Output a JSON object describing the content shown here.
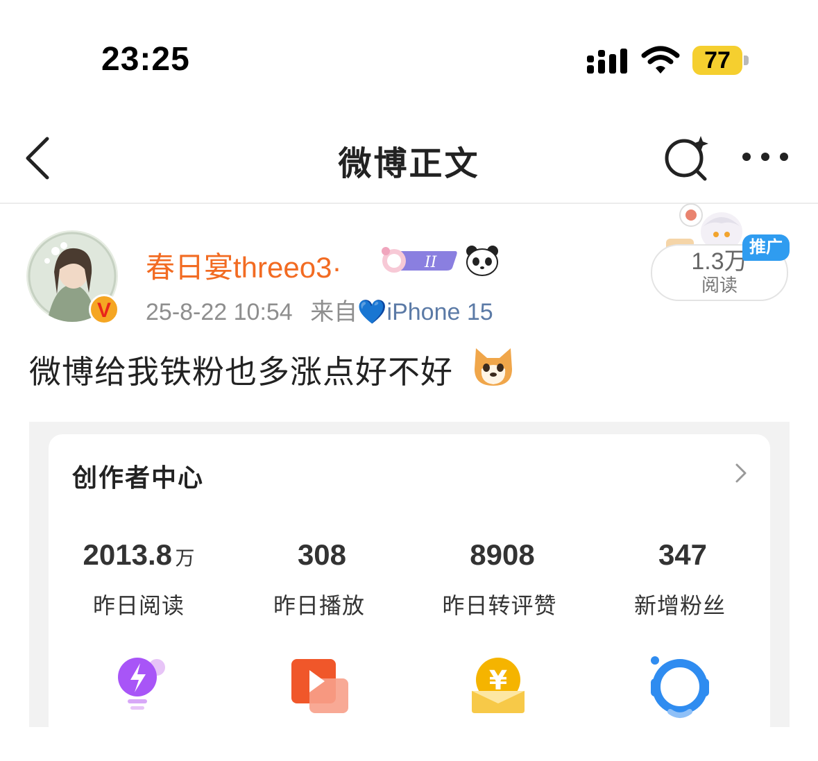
{
  "status_bar": {
    "time": "23:25",
    "battery": "77"
  },
  "nav": {
    "title": "微博正文"
  },
  "post": {
    "username": "春日宴threeo3·",
    "time": "25-8-22 10:54",
    "source_prefix": "来自",
    "device": "iPhone 15",
    "text": "微博给我铁粉也多涨点好不好",
    "reads": {
      "count": "1.3万",
      "label": "阅读",
      "tag": "推广"
    }
  },
  "creator_center": {
    "title": "创作者中心",
    "stats": [
      {
        "value": "2013.8",
        "unit": "万",
        "label": "昨日阅读"
      },
      {
        "value": "308",
        "unit": "",
        "label": "昨日播放"
      },
      {
        "value": "8908",
        "unit": "",
        "label": "昨日转评赞"
      },
      {
        "value": "347",
        "unit": "",
        "label": "新增粉丝"
      }
    ],
    "tools": [
      {
        "icon": "lightbulb-icon",
        "color": "#a855f7"
      },
      {
        "icon": "video-play-icon",
        "color": "#f0572a"
      },
      {
        "icon": "yuan-coin-icon",
        "color": "#f5b400"
      },
      {
        "icon": "headset-service-icon",
        "color": "#2f8cf0"
      }
    ]
  },
  "colors": {
    "username": "#f26b22",
    "device": "#5b7aa6",
    "battery": "#f5cf2f",
    "promo": "#2f9cf0"
  }
}
